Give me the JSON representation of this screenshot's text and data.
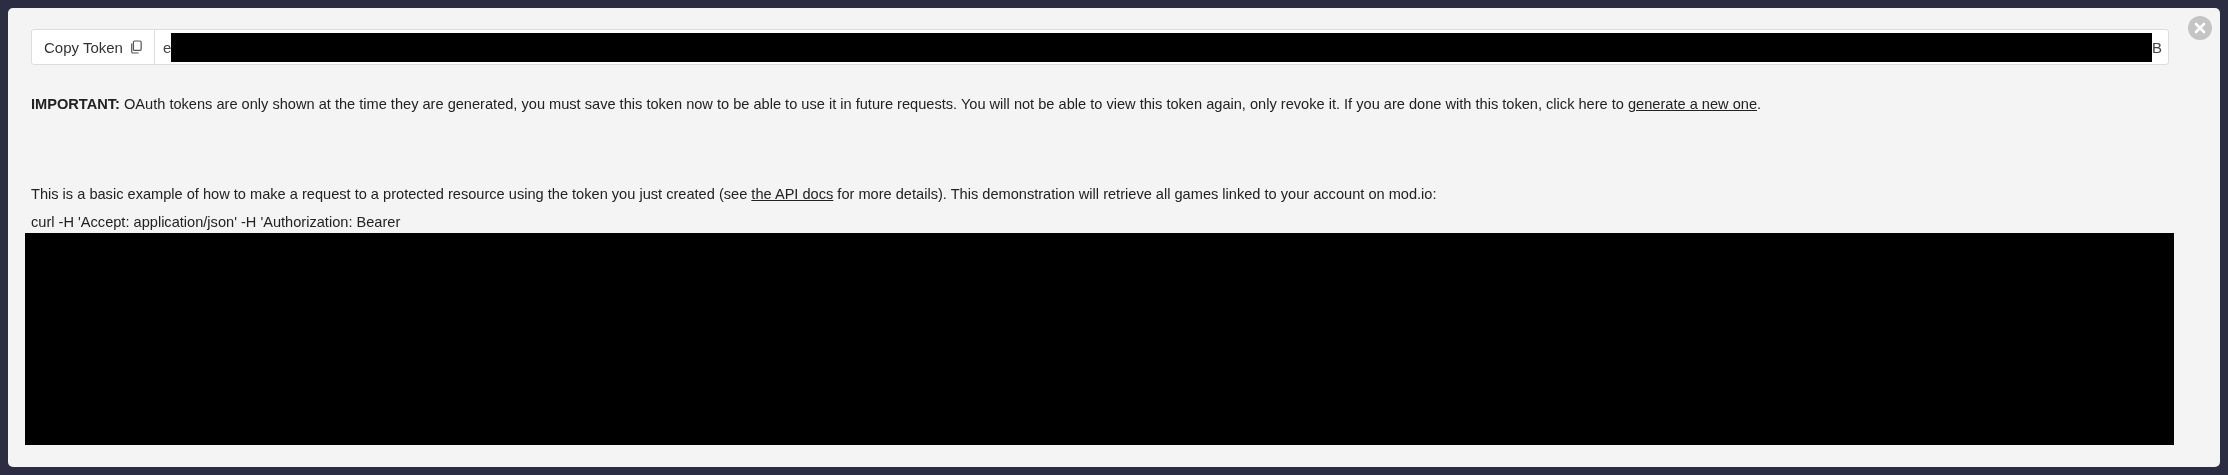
{
  "token_bar": {
    "copy_button": "Copy Token",
    "token_start": "e",
    "token_end": "B"
  },
  "notice": {
    "text": "**IMPORTANT:** OAuth tokens are only shown at the time they are generated, you must save this token now to be able to use it in future requests. You will not be able to view this token again, only revoke it. If you are done with this token, click here to ",
    "link": "generate a new one",
    "after": "."
  },
  "example": {
    "before": "This is a basic example of how to make a request to a protected resource using the token you just created (see ",
    "link": "the API docs",
    "after": " for more details). This demonstration will retrieve all games linked to your account on mod.io:"
  },
  "code": {
    "line": "curl -H 'Accept: application/json' -H 'Authorization: Bearer"
  }
}
